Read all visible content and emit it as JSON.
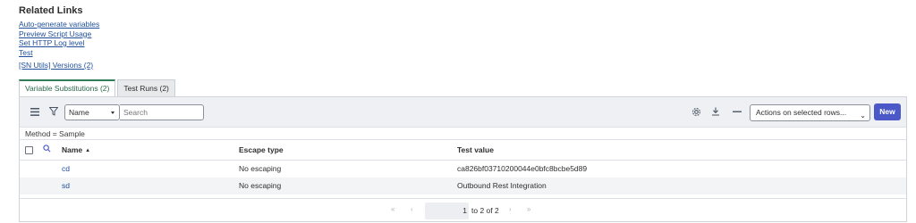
{
  "related_links": {
    "title": "Related Links",
    "links": [
      "Auto-generate variables",
      "Preview Script Usage",
      "Set HTTP Log level",
      "Test"
    ],
    "extra_link": "[SN Utils] Versions (2)"
  },
  "tabs": [
    {
      "label": "Variable Substitutions (2)",
      "active": true
    },
    {
      "label": "Test Runs (2)",
      "active": false
    }
  ],
  "toolbar": {
    "field_select": "Name",
    "search_placeholder": "Search",
    "actions_select": "Actions on selected rows...",
    "new_label": "New"
  },
  "filter": "Method = Sample",
  "table": {
    "columns": [
      "Name",
      "Escape type",
      "Test value"
    ],
    "rows": [
      {
        "name": "cd",
        "escape_type": "No escaping",
        "test_value": "ca826bf03710200044e0bfc8bcbe5d89"
      },
      {
        "name": "sd",
        "escape_type": "No escaping",
        "test_value": "Outbound Rest Integration"
      }
    ]
  },
  "pagination": {
    "current": "1",
    "text": "to 2 of 2"
  },
  "colors": {
    "accent": "#4a58c8",
    "active_tab": "#2f7f56",
    "link": "#1f4f9a"
  }
}
